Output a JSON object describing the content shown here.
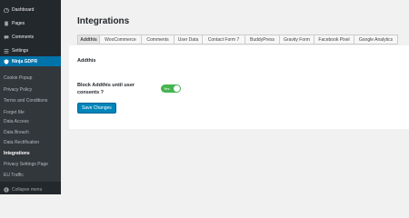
{
  "sidebar": {
    "items": [
      {
        "label": "Dashboard",
        "icon": "dashboard-icon"
      },
      {
        "label": "Pages",
        "icon": "pages-icon"
      },
      {
        "label": "Comments",
        "icon": "comments-icon"
      },
      {
        "label": "Settings",
        "icon": "settings-icon"
      },
      {
        "label": "Ninja GDPR",
        "icon": "shield-icon"
      }
    ],
    "submenu": [
      "Cookie Popup",
      "Privacy Policy",
      "Terms and Conditions",
      "Forget Me",
      "Data Access",
      "Data Breach",
      "Data Rectification",
      "Integrations",
      "Privacy Settings Page",
      "EU Traffic"
    ],
    "collapse_label": "Collapse menu"
  },
  "page": {
    "title": "Integrations",
    "tabs": [
      "Addthis",
      "WooCommerce",
      "Comments",
      "User Data",
      "Contact Form 7",
      "BuddyPress",
      "Gravity Form",
      "Facebook Pixel",
      "Google Analytics"
    ],
    "section_title": "Addthis",
    "field_label": "Block Addthis until user consents ?",
    "toggle_text": "Yes",
    "save_label": "Save Changes"
  },
  "colors": {
    "sidebar_bg": "#23282d",
    "active_blue": "#0073aa",
    "toggle_green": "#46b450",
    "button_blue": "#0085ba"
  }
}
